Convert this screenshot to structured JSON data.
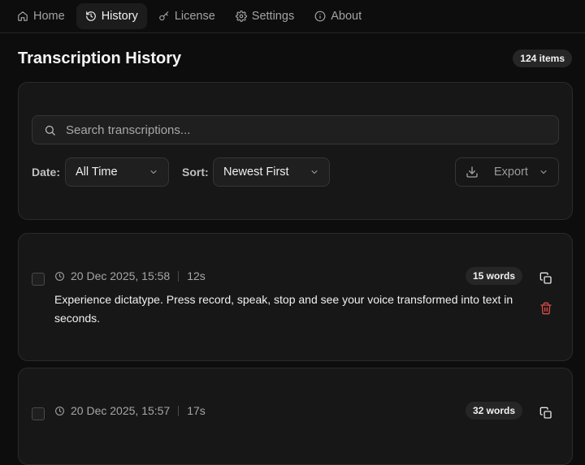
{
  "nav": {
    "items": [
      {
        "label": "Home",
        "icon": "home-icon"
      },
      {
        "label": "History",
        "icon": "history-icon"
      },
      {
        "label": "License",
        "icon": "key-icon"
      },
      {
        "label": "Settings",
        "icon": "gear-icon"
      },
      {
        "label": "About",
        "icon": "info-icon"
      }
    ],
    "active": "History"
  },
  "header": {
    "title": "Transcription History",
    "count": "124 items"
  },
  "filters": {
    "search_placeholder": "Search transcriptions...",
    "date_label": "Date:",
    "date_value": "All Time",
    "sort_label": "Sort:",
    "sort_value": "Newest First",
    "export_label": "Export"
  },
  "entries": [
    {
      "date": "20 Dec 2025, 15:58",
      "duration": "12s",
      "words": "15 words",
      "text": "Experience dictatype. Press record, speak, stop and see your voice transformed into text in seconds."
    },
    {
      "date": "20 Dec 2025, 15:57",
      "duration": "17s",
      "words": "32 words",
      "text": ""
    }
  ],
  "colors": {
    "background": "#0d0d0d",
    "card": "#171717",
    "delete": "#dc4a4a"
  }
}
